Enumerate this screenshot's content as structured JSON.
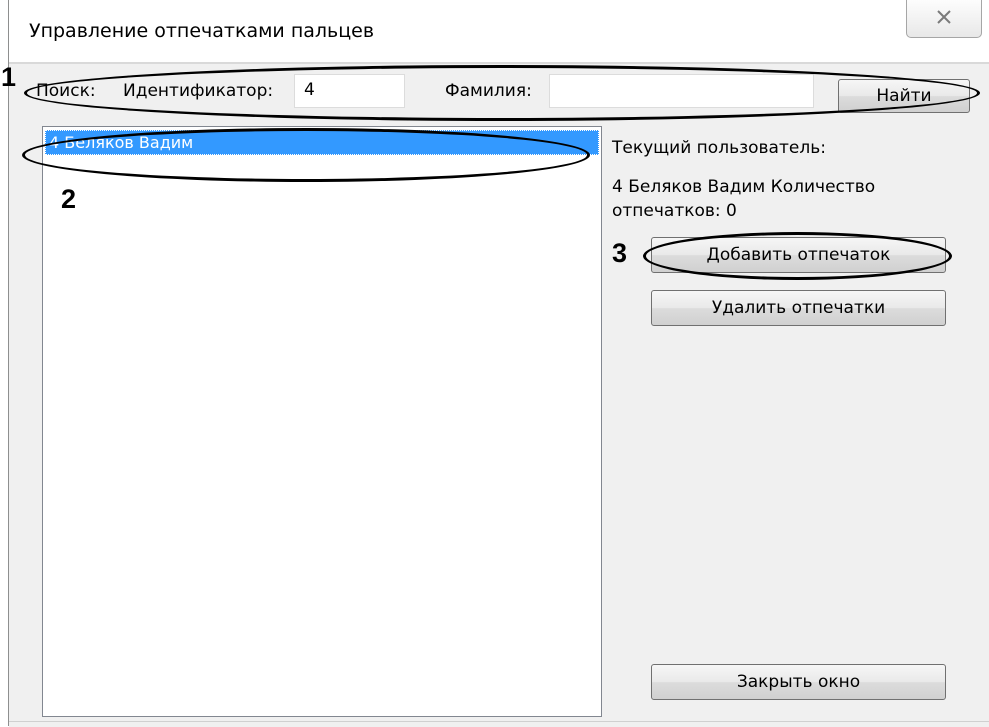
{
  "window": {
    "title": "Управление отпечатками пальцев",
    "close_glyph": "✕"
  },
  "search": {
    "label": "Поиск:",
    "id_label": "Идентификатор:",
    "id_value": "4",
    "surname_label": "Фамилия:",
    "surname_value": "",
    "find_button": "Найти"
  },
  "users": {
    "items": [
      {
        "label": "4 Беляков Вадим",
        "selected": true
      }
    ]
  },
  "current_user": {
    "heading": "Текущий пользователь:",
    "info": "4 Беляков Вадим Количество отпечатков: 0"
  },
  "actions": {
    "add_button": "Добавить отпечаток",
    "delete_button": "Удалить отпечатки",
    "close_button": "Закрыть окно"
  },
  "callouts": {
    "one": "1",
    "two": "2",
    "three": "3"
  },
  "colors": {
    "selection": "#3399ff",
    "window_bg": "#f0f0f0",
    "annotation": "#000000"
  }
}
